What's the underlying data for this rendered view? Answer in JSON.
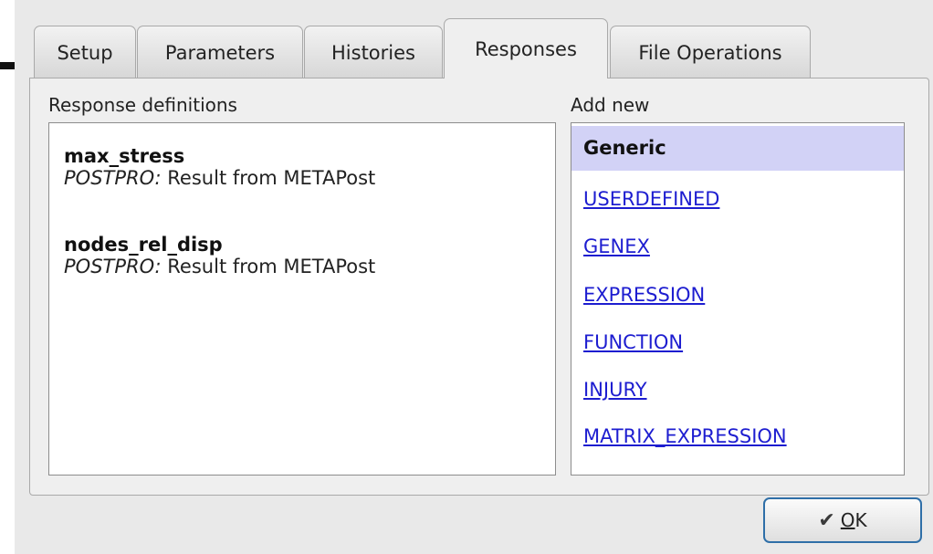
{
  "tabs": [
    {
      "label": "Setup"
    },
    {
      "label": "Parameters"
    },
    {
      "label": "Histories"
    },
    {
      "label": "Responses"
    },
    {
      "label": "File Operations"
    }
  ],
  "left_panel": {
    "title": "Response definitions",
    "responses": [
      {
        "name": "max_stress",
        "type": "POSTPRO:",
        "description": " Result from METAPost"
      },
      {
        "name": "nodes_rel_disp",
        "type": "POSTPRO:",
        "description": " Result from METAPost"
      }
    ]
  },
  "right_panel": {
    "title": "Add new",
    "items": [
      {
        "label": "Generic"
      },
      {
        "label": "USERDEFINED"
      },
      {
        "label": "GENEX"
      },
      {
        "label": "EXPRESSION"
      },
      {
        "label": "FUNCTION"
      },
      {
        "label": "INJURY"
      },
      {
        "label": "MATRIX_EXPRESSION"
      }
    ]
  },
  "ok_button": {
    "accel": "O",
    "rest": "K",
    "icon": "checkmark-icon"
  }
}
